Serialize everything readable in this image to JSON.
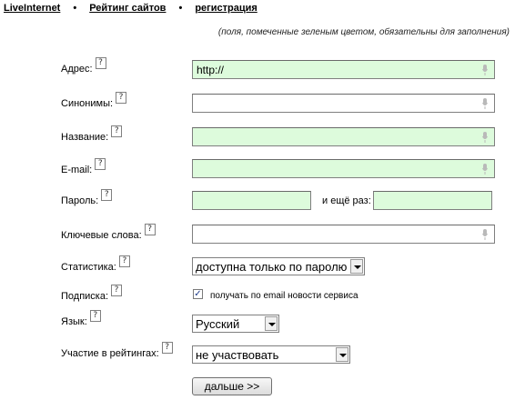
{
  "nav": {
    "links": [
      "LiveInternet",
      "Рейтинг сайтов",
      "регистрация"
    ],
    "separator": "•"
  },
  "hint": "(поля, помеченные зеленым цветом, обязательны для заполнения)",
  "help_glyph": "?",
  "form": {
    "address": {
      "label": "Адрес:",
      "value": "http://",
      "required": true
    },
    "synonyms": {
      "label": "Синонимы:",
      "value": "",
      "required": false
    },
    "name": {
      "label": "Название:",
      "value": "",
      "required": true
    },
    "email": {
      "label": "E-mail:",
      "value": "",
      "required": true
    },
    "password": {
      "label": "Пароль:",
      "value": "",
      "again_label": "и ещё раз:",
      "required": true
    },
    "keywords": {
      "label": "Ключевые слова:",
      "value": ""
    },
    "statistics": {
      "label": "Статистика:",
      "selected": "доступна только по паролю"
    },
    "subscription": {
      "label": "Подписка:",
      "checked": true,
      "check_label": "получать по email новости сервиса"
    },
    "language": {
      "label": "Язык:",
      "selected": "Русский"
    },
    "ratings": {
      "label": "Участие в рейтингах:",
      "selected": "не участвовать"
    },
    "submit_label": "дальше >>"
  },
  "colors": {
    "required_field": "#ddfbdc"
  },
  "icons": {
    "help": "help-icon",
    "voice": "microphone-icon",
    "dropdown": "chevron-down-icon",
    "checkmark": "checkmark-icon"
  }
}
